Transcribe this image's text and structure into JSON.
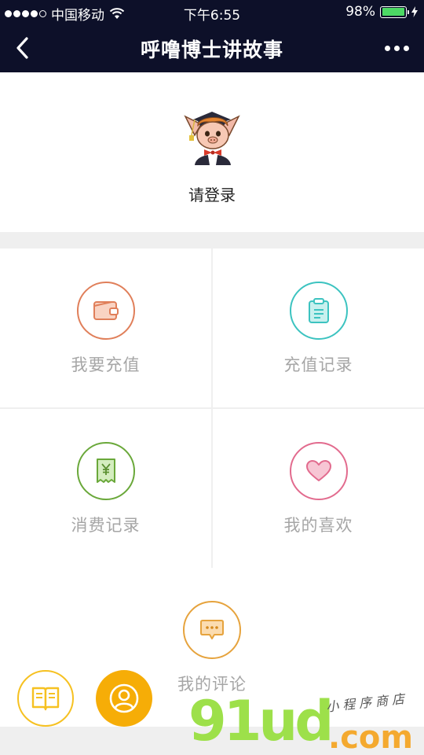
{
  "status_bar": {
    "carrier": "中国移动",
    "time": "下午6:55",
    "battery": "98%",
    "battery_level": 0.98
  },
  "nav": {
    "title": "呼噜博士讲故事"
  },
  "profile": {
    "login_text": "请登录"
  },
  "menu": [
    {
      "label": "我要充值",
      "icon": "wallet-icon",
      "color": "#e07f5a"
    },
    {
      "label": "充值记录",
      "icon": "clipboard-icon",
      "color": "#3cc3c0"
    },
    {
      "label": "消费记录",
      "icon": "receipt-yen-icon",
      "color": "#6aa83a"
    },
    {
      "label": "我的喜欢",
      "icon": "heart-icon",
      "color": "#e26b8e"
    },
    {
      "label": "我的评论",
      "icon": "comment-icon",
      "color": "#e6a33d"
    }
  ],
  "bottom_bar": {
    "book_icon": "book-icon",
    "user_icon": "user-icon",
    "book_color": "#f6c121",
    "user_color": "#f6ad07"
  },
  "watermark": {
    "logo": "91ud",
    "sub": "小程序商店",
    "domain": ".com"
  }
}
